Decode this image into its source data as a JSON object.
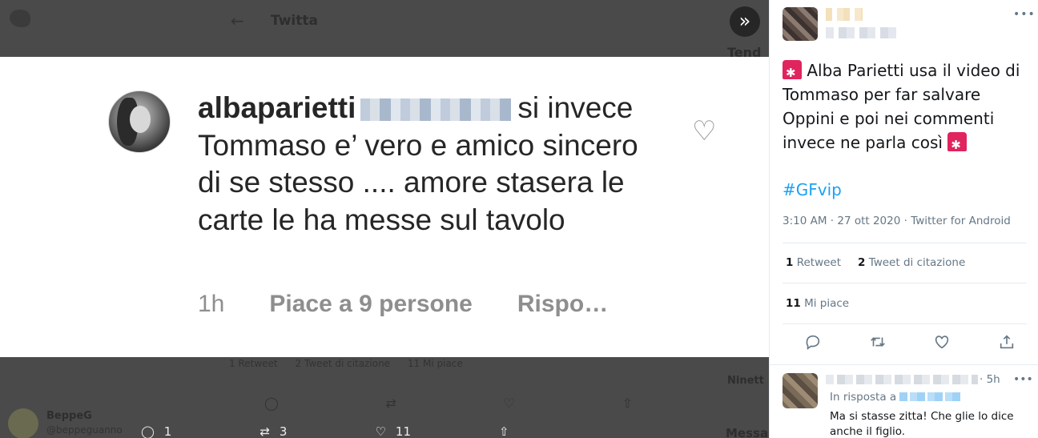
{
  "background": {
    "header_title": "Twitta",
    "trending_label": "Tend",
    "stats": [
      "1 Retweet",
      "2 Tweet di citazione",
      "11 Mi piace"
    ],
    "side_heading": "Ninett",
    "user_name": "BeppeG",
    "user_handle": "@beppeguanno",
    "bottom_counts": {
      "reply": "1",
      "retweet": "3",
      "like": "11"
    },
    "messages_label": "Messa"
  },
  "media": {
    "expand_icon": "»",
    "comment": {
      "username": "albaparietti",
      "text": "si invece Tommaso e’ vero e amico sincero di se stesso .... amore stasera le carte le ha messe sul tavolo",
      "time": "1h",
      "likes": "Piace a 9 persone",
      "reply": "Rispo…"
    }
  },
  "tweet": {
    "more_icon": "•••",
    "text": "Alba Parietti usa il video di Tommaso per far salvare Oppini e poi nei commenti invece ne parla così",
    "hashtag": "#GFvip",
    "timestamp": "3:10 AM · 27 ott 2020",
    "separator": " · ",
    "source": "Twitter for Android",
    "retweets_count": "1",
    "retweets_label": "Retweet",
    "quotes_count": "2",
    "quotes_label": "Tweet di citazione",
    "likes_count": "11",
    "likes_label": "Mi piace",
    "actions": [
      "reply-icon",
      "retweet-icon",
      "like-icon",
      "share-icon"
    ]
  },
  "reply": {
    "time": "· 5h",
    "more_icon": "•••",
    "in_reply_to": "In risposta a",
    "text": "Ma si stasse zitta! Che glie lo dice anche il figlio."
  },
  "colors": {
    "accent": "#1da1f2",
    "siren": "#e0245e",
    "text": "#14171a",
    "muted": "#657786"
  }
}
